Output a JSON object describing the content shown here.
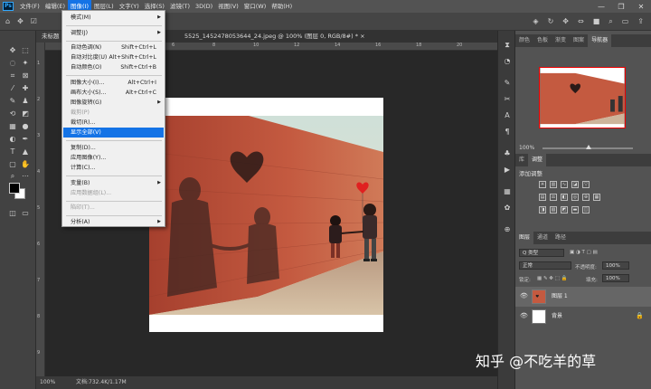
{
  "menubar": {
    "logo": "Ps",
    "items": [
      "文件(F)",
      "编辑(E)",
      "图像(I)",
      "图层(L)",
      "文字(Y)",
      "选择(S)",
      "滤镜(T)",
      "3D(D)",
      "视图(V)",
      "窗口(W)",
      "帮助(H)"
    ],
    "window_controls": [
      "—",
      "❐",
      "✕"
    ]
  },
  "document": {
    "tab_label": "未标题",
    "title": "5525_1452478053644_24.jpeg @ 100% (图层 0, RGB/8#) *",
    "close": "×",
    "status": "100%",
    "file_size": "文档:732.4K/1.17M",
    "ruler_top": [
      "4",
      "6",
      "8",
      "10",
      "12",
      "14",
      "16",
      "18",
      "20"
    ],
    "ruler_left": [
      "1",
      "2",
      "3",
      "4",
      "5",
      "6",
      "7",
      "8",
      "9"
    ]
  },
  "image_menu": {
    "items": [
      {
        "label": "模式(M)",
        "shortcut": "",
        "submenu": true,
        "disabled": false,
        "highlighted": false
      },
      {
        "label": "调整(J)",
        "shortcut": "",
        "submenu": true,
        "disabled": false,
        "highlighted": false
      },
      {
        "label": "自动色调(N)",
        "shortcut": "Shift+Ctrl+L",
        "submenu": false,
        "disabled": false,
        "highlighted": false
      },
      {
        "label": "自动对比度(U)",
        "shortcut": "Alt+Shift+Ctrl+L",
        "submenu": false,
        "disabled": false,
        "highlighted": false
      },
      {
        "label": "自动颜色(O)",
        "shortcut": "Shift+Ctrl+B",
        "submenu": false,
        "disabled": false,
        "highlighted": false
      },
      {
        "label": "图像大小(I)...",
        "shortcut": "Alt+Ctrl+I",
        "submenu": false,
        "disabled": false,
        "highlighted": false
      },
      {
        "label": "画布大小(S)...",
        "shortcut": "Alt+Ctrl+C",
        "submenu": false,
        "disabled": false,
        "highlighted": false
      },
      {
        "label": "图像旋转(G)",
        "shortcut": "",
        "submenu": true,
        "disabled": false,
        "highlighted": false
      },
      {
        "label": "裁剪(P)",
        "shortcut": "",
        "submenu": false,
        "disabled": true,
        "highlighted": false
      },
      {
        "label": "裁切(R)...",
        "shortcut": "",
        "submenu": false,
        "disabled": false,
        "highlighted": false
      },
      {
        "label": "显示全部(V)",
        "shortcut": "",
        "submenu": false,
        "disabled": false,
        "highlighted": true
      },
      {
        "label": "复制(D)...",
        "shortcut": "",
        "submenu": false,
        "disabled": false,
        "highlighted": false
      },
      {
        "label": "应用图像(Y)...",
        "shortcut": "",
        "submenu": false,
        "disabled": false,
        "highlighted": false
      },
      {
        "label": "计算(C)...",
        "shortcut": "",
        "submenu": false,
        "disabled": false,
        "highlighted": false
      },
      {
        "label": "变量(B)",
        "shortcut": "",
        "submenu": true,
        "disabled": false,
        "highlighted": false
      },
      {
        "label": "应用数据组(L)...",
        "shortcut": "",
        "submenu": false,
        "disabled": true,
        "highlighted": false
      },
      {
        "label": "陷印(T)...",
        "shortcut": "",
        "submenu": false,
        "disabled": true,
        "highlighted": false
      },
      {
        "label": "分析(A)",
        "shortcut": "",
        "submenu": true,
        "disabled": false,
        "highlighted": false
      }
    ]
  },
  "panels": {
    "top_tabs": [
      "颜色",
      "色板",
      "渐变",
      "图案",
      "导航器"
    ],
    "navigator_zoom": "100%",
    "adj_tabs": [
      "库",
      "调整"
    ],
    "adj_label": "添加调整",
    "layer_tabs": [
      "图层",
      "通道",
      "路径"
    ],
    "kind": "Q 类型",
    "blend_mode": "正常",
    "opacity_label": "不透明度:",
    "opacity": "100%",
    "lock_label": "锁定:",
    "fill_label": "填充:",
    "fill": "100%",
    "layers": [
      {
        "name": "图层 1",
        "selected": true
      },
      {
        "name": "背景",
        "selected": false
      }
    ]
  },
  "watermark": "知乎 @不吃羊的草",
  "colors": {
    "accent": "#1473e6",
    "wall": "#c0503a",
    "heart": "#2a1a18",
    "balloon": "#e02020"
  }
}
